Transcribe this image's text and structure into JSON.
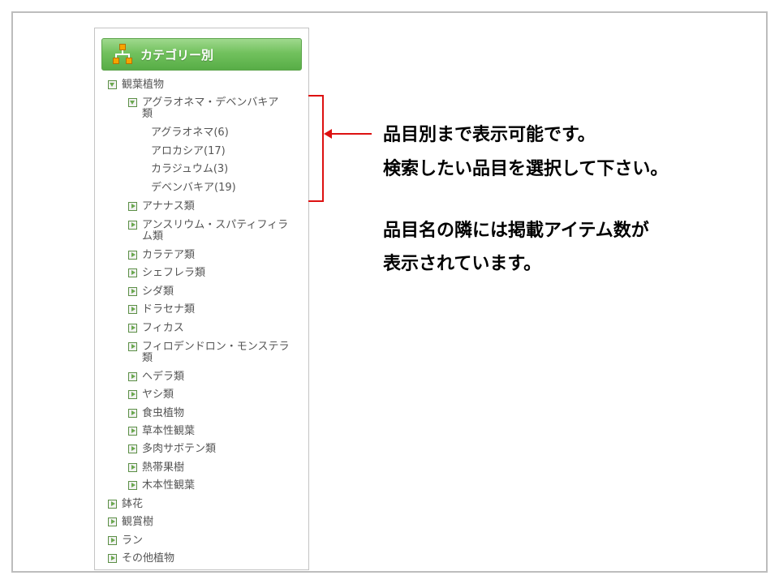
{
  "panel": {
    "header_title": "カテゴリー別",
    "header_icon": "category-tree-icon"
  },
  "tree": {
    "root1": "観葉植物",
    "sub_open": "アグラオネマ・デベンバキア",
    "sub_open_cont": "類",
    "leaf1": "アグラオネマ(6)",
    "leaf2": "アロカシア(17)",
    "leaf3": "カラジュウム(3)",
    "leaf4": "デベンバキア(19)",
    "sub2": "アナナス類",
    "sub3": "アンスリウム・スパティフィラ",
    "sub3_cont": "ム類",
    "sub4": "カラテア類",
    "sub5": "シェフレラ類",
    "sub6": "シダ類",
    "sub7": "ドラセナ類",
    "sub8": "フィカス",
    "sub9": "フィロデンドロン・モンステラ",
    "sub9_cont": "類",
    "sub10": "ヘデラ類",
    "sub11": "ヤシ類",
    "sub12": "食虫植物",
    "sub13": "草本性観葉",
    "sub14": "多肉サボテン類",
    "sub15": "熱帯果樹",
    "sub16": "木本性観葉",
    "root2": "鉢花",
    "root3": "観賞樹",
    "root4": "ラン",
    "root5": "その他植物"
  },
  "annotation": {
    "line1": "品目別まで表示可能です。",
    "line2": "検索したい品目を選択して下さい。",
    "line3": "品目名の隣には掲載アイテム数が",
    "line4": "表示されています。",
    "color": "#dd1111"
  }
}
